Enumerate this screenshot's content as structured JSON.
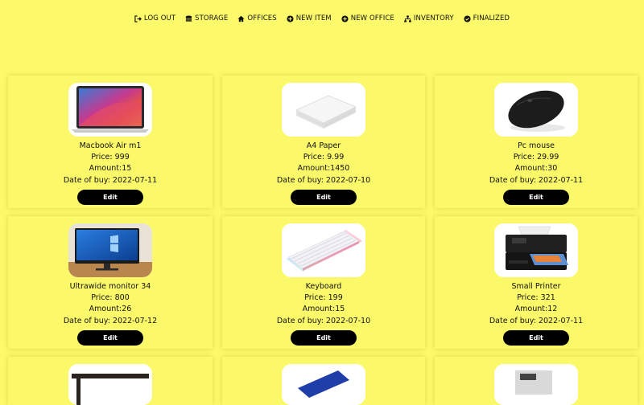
{
  "nav": [
    {
      "label": "LOG OUT",
      "icon": "logout-icon"
    },
    {
      "label": "STORAGE",
      "icon": "database-icon"
    },
    {
      "label": "OFFICES",
      "icon": "home-icon"
    },
    {
      "label": "NEW ITEM",
      "icon": "plus-circle-icon"
    },
    {
      "label": "NEW OFFICE",
      "icon": "plus-circle-icon"
    },
    {
      "label": "INVENTORY",
      "icon": "sitemap-icon"
    },
    {
      "label": "FINALIZED",
      "icon": "check-circle-icon"
    }
  ],
  "items": [
    {
      "name": "Macbook Air m1",
      "price": "Price: 999",
      "amount": "Amount:15",
      "date": "Date of buy: 2022-07-11",
      "edit": "Edit",
      "image": "laptop"
    },
    {
      "name": "A4 Paper",
      "price": "Price: 9.99",
      "amount": "Amount:1450",
      "date": "Date of buy: 2022-07-10",
      "edit": "Edit",
      "image": "paper"
    },
    {
      "name": "Pc mouse",
      "price": "Price: 29.99",
      "amount": "Amount:30",
      "date": "Date of buy: 2022-07-11",
      "edit": "Edit",
      "image": "mouse"
    },
    {
      "name": "Ultrawide monitor 34",
      "price": "Price: 800",
      "amount": "Amount:26",
      "date": "Date of buy: 2022-07-12",
      "edit": "Edit",
      "image": "monitor"
    },
    {
      "name": "Keyboard",
      "price": "Price: 199",
      "amount": "Amount:15",
      "date": "Date of buy: 2022-07-10",
      "edit": "Edit",
      "image": "keyboard"
    },
    {
      "name": "Small Printer",
      "price": "Price: 321",
      "amount": "Amount:12",
      "date": "Date of buy: 2022-07-11",
      "edit": "Edit",
      "image": "printer"
    }
  ],
  "colors": {
    "background": "#fcfa6b",
    "button": "#000000",
    "button_text": "#ffffff"
  }
}
